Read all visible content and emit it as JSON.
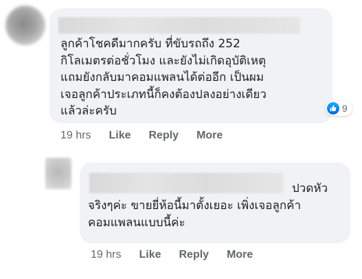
{
  "comment": {
    "text": "ลูกค้าโชคดีมากครับ ที่ขับรถถึง 252\nกิโลเมตรต่อชั่วโมง และยังไม่เกิดอุบัติเหตุ\nแถมยังกลับมาคอมแพลนได้ต่ออีก เป็นผม\nเจอลูกค้าประเภทนี้ก็คงต้องปลงอย่างเดียว\nแล้วล่ะครับ",
    "reaction_icon": "like-icon",
    "reaction_count": "9",
    "timestamp": "19 hrs",
    "like_label": "Like",
    "reply_label": "Reply",
    "more_label": "More"
  },
  "reply": {
    "text_first_line": "ปวดหัว",
    "text": "จริงๆค่ะ ขายยี่ห้อนี้มาตั้งเยอะ เพิ่งเจอลูกค้า\nคอมแพลนแบบนี้ค่ะ",
    "timestamp": "19 hrs",
    "like_label": "Like",
    "reply_label": "Reply",
    "more_label": "More"
  },
  "colors": {
    "bubble": "#f0f2f5",
    "text": "#1c1e21",
    "meta": "#65676b",
    "like_blue": "#1877f2"
  }
}
